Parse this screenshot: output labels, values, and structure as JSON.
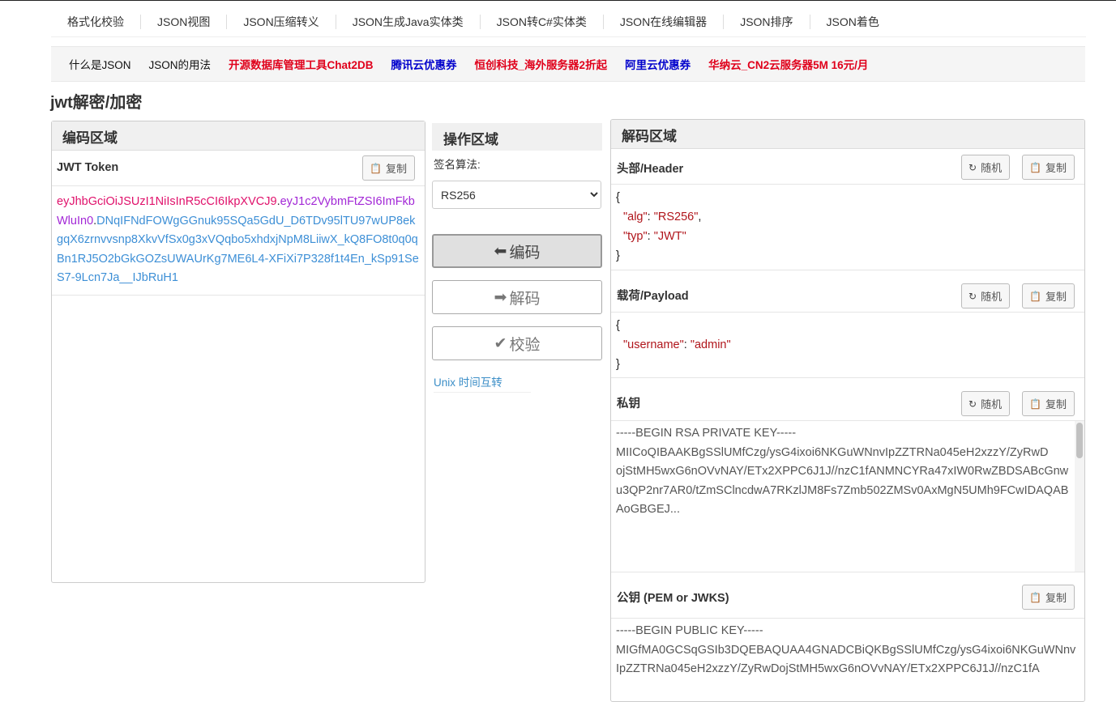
{
  "nav": {
    "items": [
      "格式化校验",
      "JSON视图",
      "JSON压缩转义",
      "JSON生成Java实体类",
      "JSON转C#实体类",
      "JSON在线编辑器",
      "JSON排序",
      "JSON着色"
    ]
  },
  "subnav": {
    "items": [
      {
        "label": "什么是JSON",
        "color": "#111111"
      },
      {
        "label": "JSON的用法",
        "color": "#111111"
      },
      {
        "label": "开源数据库管理工具Chat2DB",
        "color": "#e0001b"
      },
      {
        "label": "腾讯云优惠券",
        "color": "#0000cc"
      },
      {
        "label": "恒创科技_海外服务器2折起",
        "color": "#e0001b"
      },
      {
        "label": "阿里云优惠券",
        "color": "#0000cc"
      },
      {
        "label": "华纳云_CN2云服务器5M 16元/月",
        "color": "#e0001b"
      }
    ]
  },
  "page": {
    "title": "jwt解密/加密"
  },
  "encode": {
    "title": "编码区域",
    "token_label": "JWT Token",
    "copy_label": "复制",
    "token_header": "eyJhbGciOiJSUzI1NiIsInR5cCI6IkpXVCJ9",
    "dot": ".",
    "token_payload": "eyJ1c2VybmFtZSI6ImFkbWluIn0",
    "token_signature": "DNqIFNdFOWgGGnuk95SQa5GdU_D6TDv95lTU97wUP8ekgqX6zrnvvsnp8XkvVfSx0g3xVQqbo5xhdxjNpM8LiiwX_kQ8FO8t0q0qBn1RJ5O2bGkGOZsUWAUrKg7ME6L4-XFiXi7P328f1t4En_kSp91SeS7-9Lcn7Ja__IJbRuH1"
  },
  "ops": {
    "title": "操作区域",
    "algo_label": "签名算法:",
    "algo_selected": "RS256",
    "encode_btn": "编码",
    "decode_btn": "解码",
    "verify_btn": "校验",
    "unix_link": "Unix 时间互转"
  },
  "decode": {
    "title": "解码区域",
    "random_label": "随机",
    "copy_label": "复制",
    "header_label": "头部/Header",
    "header_json": {
      "open": "{",
      "alg_key": "\"alg\"",
      "alg_val": "\"RS256\"",
      "typ_key": "\"typ\"",
      "typ_val": "\"JWT\"",
      "close": "}"
    },
    "payload_label": "载荷/Payload",
    "payload_json": {
      "open": "{",
      "username_key": "\"username\"",
      "username_val": "\"admin\"",
      "close": "}"
    },
    "private_key_label": "私钥",
    "private_key_lines": [
      "-----BEGIN RSA PRIVATE KEY-----",
      "MIICoQIBAAKBgSSlUMfCzg/ysG4ixoi6NKGuWNnvIpZZTRNa045eH2xzzY/ZyRwD",
      "ojStMH5wxG6nOVvNAY/ETx2XPPC6J1J//nzC1fANMNCYRa47xIW0RwZBDSABcGnw",
      "u3QP2nr7AR0/tZmSClncdwA7RKzlJM8Fs7Zmb502ZMSv0AxMgN5UMh9FCwIDAQAB",
      "AoGBGEJ..."
    ],
    "public_key_label": "公钥 (PEM or JWKS)",
    "public_key_lines": [
      "-----BEGIN PUBLIC KEY-----",
      "MIGfMA0GCSqGSIb3DQEBAQUAA4GNADCBiQKBgSSlUMfCzg/ysG4ixoi6NKGuWNnv",
      "IpZZTRNa045eH2xzzY/ZyRwDojStMH5wxG6nOVvNAY/ETx2XPPC6J1J//nzC1fA"
    ]
  }
}
